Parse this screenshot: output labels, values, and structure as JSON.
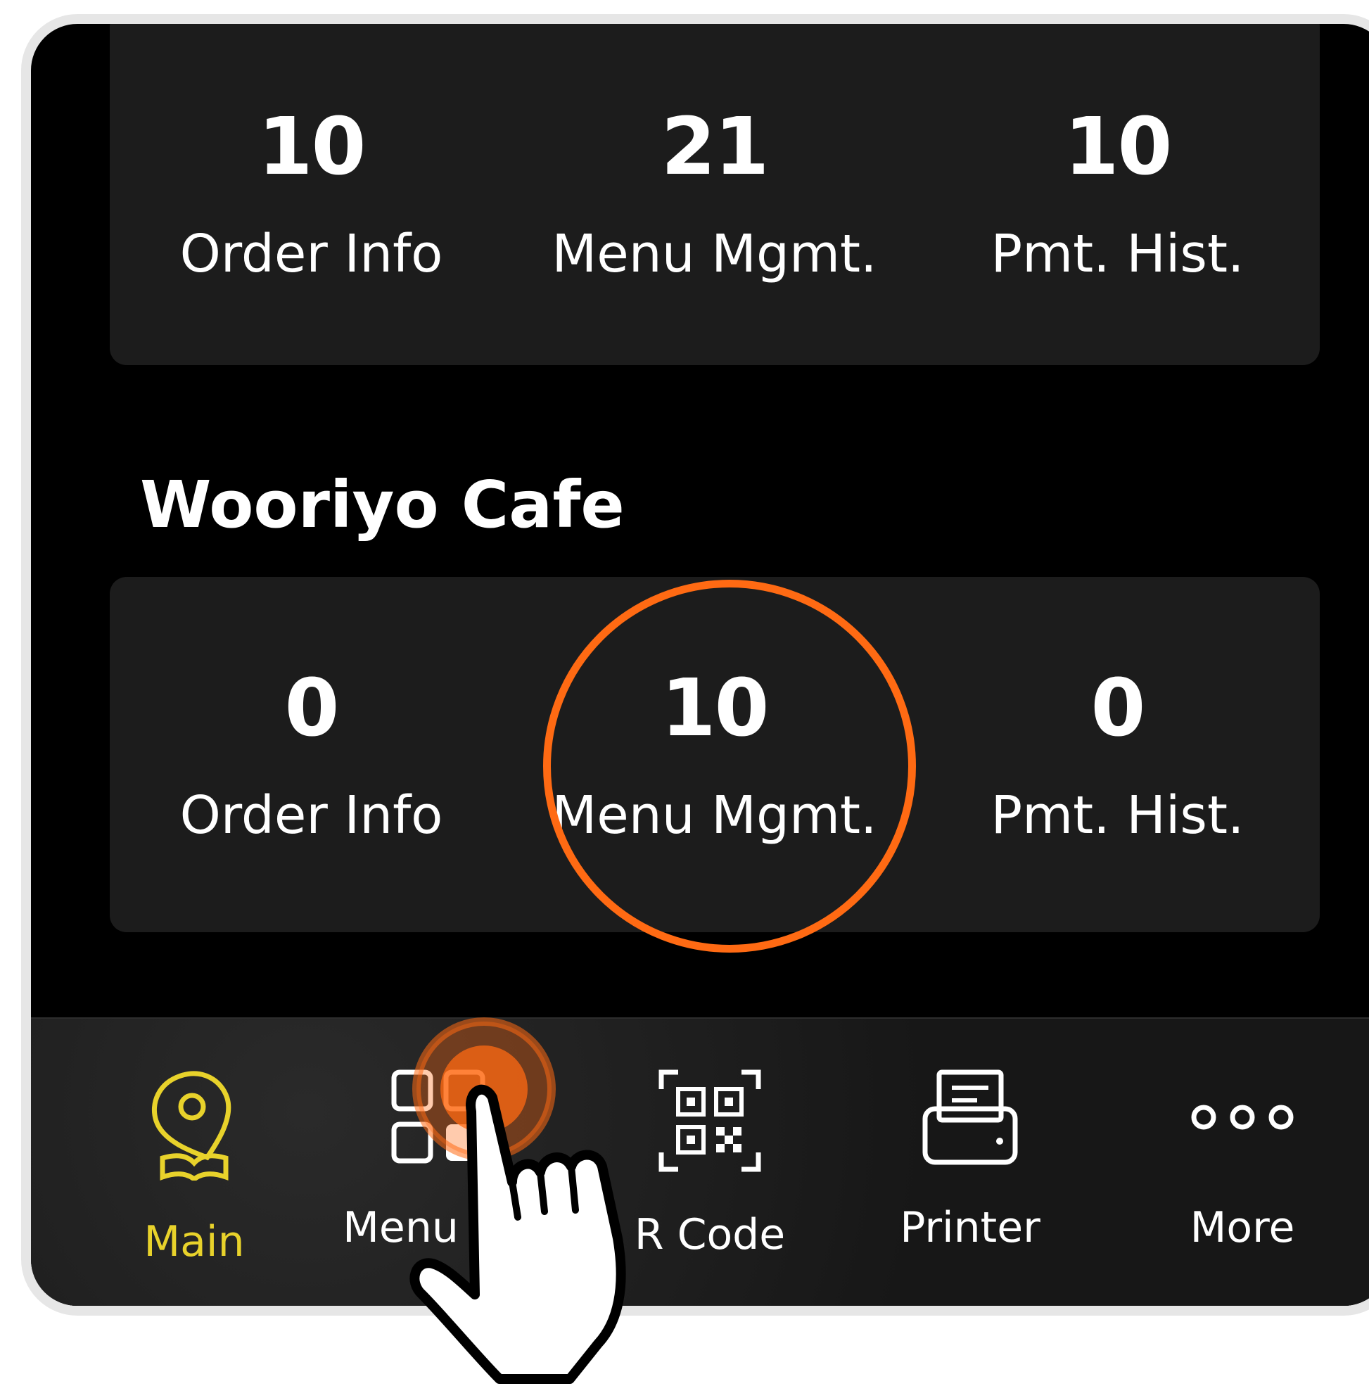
{
  "top_stats": [
    {
      "value": "10",
      "label": "Order Info"
    },
    {
      "value": "21",
      "label": "Menu Mgmt."
    },
    {
      "value": "10",
      "label": "Pmt. Hist."
    }
  ],
  "cafe": {
    "name": "Wooriyo Cafe",
    "stats": [
      {
        "value": "0",
        "label": "Order Info"
      },
      {
        "value": "10",
        "label": "Menu Mgmt."
      },
      {
        "value": "0",
        "label": "Pmt. Hist."
      }
    ]
  },
  "tabbar": {
    "items": [
      {
        "label": "Main",
        "icon": "map-pin-book-icon",
        "active": true
      },
      {
        "label": "Menu Mg",
        "icon": "menu-grid-add-icon",
        "active": false
      },
      {
        "label": "R Code",
        "icon": "qr-code-icon",
        "active": false
      },
      {
        "label": "Printer",
        "icon": "printer-icon",
        "active": false
      },
      {
        "label": "More",
        "icon": "more-dots-icon",
        "active": false
      }
    ]
  },
  "colors": {
    "background": "#000000",
    "card": "#1c1c1c",
    "accent_active": "#e8d22b",
    "highlight_ring": "#ff6a13"
  }
}
